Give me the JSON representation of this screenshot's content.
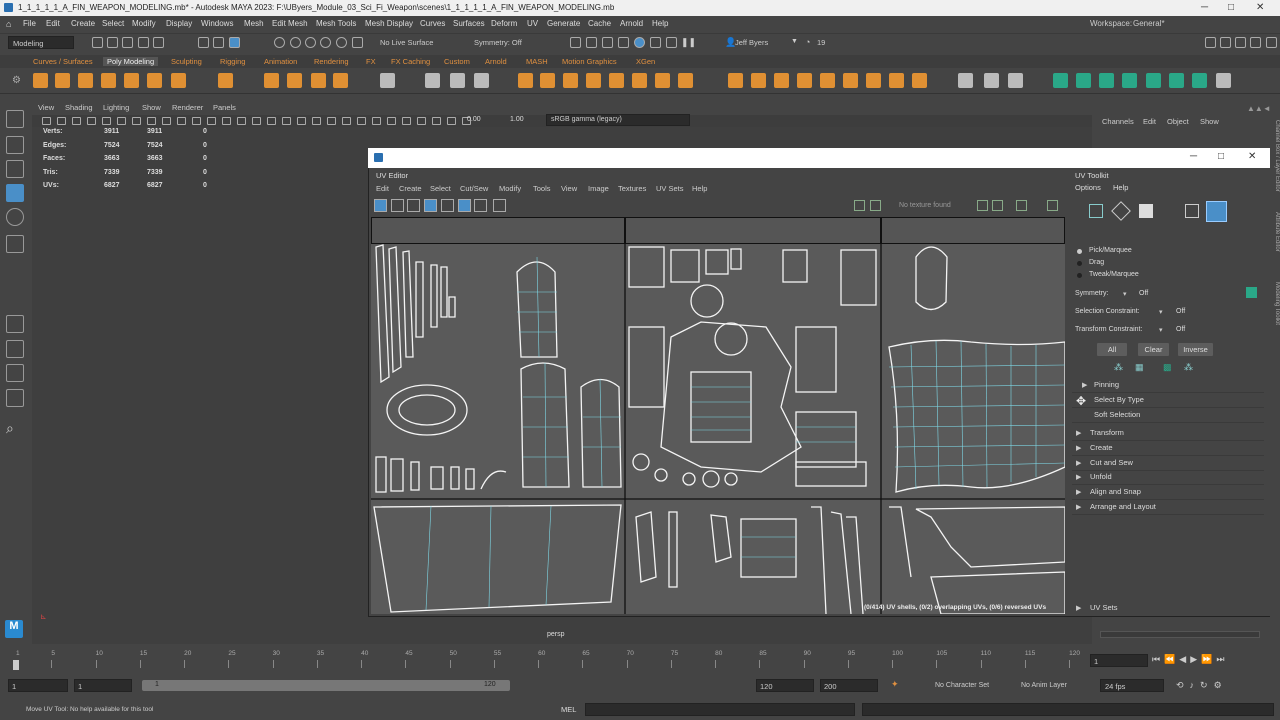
{
  "window": {
    "title": "1_1_1_1_1_A_FIN_WEAPON_MODELING.mb* - Autodesk MAYA 2023: F:\\UByers_Module_03_Sci_Fi_Weapon\\scenes\\1_1_1_1_1_A_FIN_WEAPON_MODELING.mb",
    "workspace_label": "Workspace:",
    "workspace_value": "General*"
  },
  "menu": [
    "File",
    "Edit",
    "Create",
    "Select",
    "Modify",
    "Display",
    "Windows",
    "Mesh",
    "Edit Mesh",
    "Mesh Tools",
    "Mesh Display",
    "Curves",
    "Surfaces",
    "Deform",
    "UV",
    "Generate",
    "Cache",
    "Arnold",
    "Help"
  ],
  "statusline": {
    "mode": "Modeling",
    "live_surface": "No Live Surface",
    "symmetry": "Symmetry: Off",
    "user": "Jeff Byers",
    "notifications": "19"
  },
  "shelf_tabs": [
    "Curves / Surfaces",
    "Poly Modeling",
    "Sculpting",
    "Rigging",
    "Animation",
    "Rendering",
    "FX",
    "FX Caching",
    "Custom",
    "Arnold",
    "MASH",
    "Motion Graphics",
    "XGen"
  ],
  "shelf_active": "Poly Modeling",
  "viewport": {
    "menu": [
      "View",
      "Shading",
      "Lighting",
      "Show",
      "Renderer",
      "Panels"
    ],
    "exposure": "0.00",
    "gamma": "1.00",
    "color_space": "sRGB gamma (legacy)",
    "camera": "persp",
    "hud": [
      {
        "label": "Verts:",
        "a": "3911",
        "b": "3911",
        "c": "0"
      },
      {
        "label": "Edges:",
        "a": "7524",
        "b": "7524",
        "c": "0"
      },
      {
        "label": "Faces:",
        "a": "3663",
        "b": "3663",
        "c": "0"
      },
      {
        "label": "Tris:",
        "a": "7339",
        "b": "7339",
        "c": "0"
      },
      {
        "label": "UVs:",
        "a": "6827",
        "b": "6827",
        "c": "0"
      }
    ]
  },
  "channel_box": {
    "menu": [
      "Channels",
      "Edit",
      "Object",
      "Show"
    ]
  },
  "uv_editor": {
    "title": "UV Editor",
    "menu": [
      "Edit",
      "Create",
      "Select",
      "Cut/Sew",
      "Modify",
      "Tools",
      "View",
      "Image",
      "Textures",
      "UV Sets",
      "Help"
    ],
    "texture_status": "No texture found",
    "overlay_info": "(0/414) UV shells, (0/2) overlapping UVs, (0/6) reversed UVs"
  },
  "uv_toolkit": {
    "title": "UV Toolkit",
    "menu": [
      "Options",
      "Help"
    ],
    "modes": [
      "Pick/Marquee",
      "Drag",
      "Tweak/Marquee"
    ],
    "symmetry_label": "Symmetry:",
    "symmetry_value": "Off",
    "selection_constraint_label": "Selection Constraint:",
    "selection_constraint_value": "Off",
    "transform_constraint_label": "Transform Constraint:",
    "transform_constraint_value": "Off",
    "buttons": [
      "All",
      "Clear",
      "Inverse"
    ],
    "sections": [
      "Pinning",
      "Select By Type",
      "Soft Selection",
      "Transform",
      "Create",
      "Cut and Sew",
      "Unfold",
      "Align and Snap",
      "Arrange and Layout",
      "UV Sets"
    ]
  },
  "side_tabs": [
    "Channel Box / Layer Editor",
    "Attribute Editor",
    "Modeling Toolkit"
  ],
  "timeline": {
    "ticks": [
      "1",
      "5",
      "10",
      "15",
      "20",
      "25",
      "30",
      "35",
      "40",
      "45",
      "50",
      "55",
      "60",
      "65",
      "70",
      "75",
      "80",
      "85",
      "90",
      "95",
      "100",
      "105",
      "110",
      "115",
      "120"
    ],
    "current_frame": "1"
  },
  "range": {
    "start": "1",
    "inner_start": "1",
    "slider_start": "1",
    "slider_end": "120",
    "end": "120",
    "max_end": "200",
    "character_set": "No Character Set",
    "anim_layer": "No Anim Layer",
    "fps": "24 fps"
  },
  "commandline": {
    "help": "Move UV Tool: No help available for this tool",
    "lang": "MEL"
  },
  "colors": {
    "shelf_orange": "#e09033",
    "shelf_green": "#2aa888",
    "uv_wire": "#7fd8e6",
    "selected_blue": "#4a8fc8"
  }
}
